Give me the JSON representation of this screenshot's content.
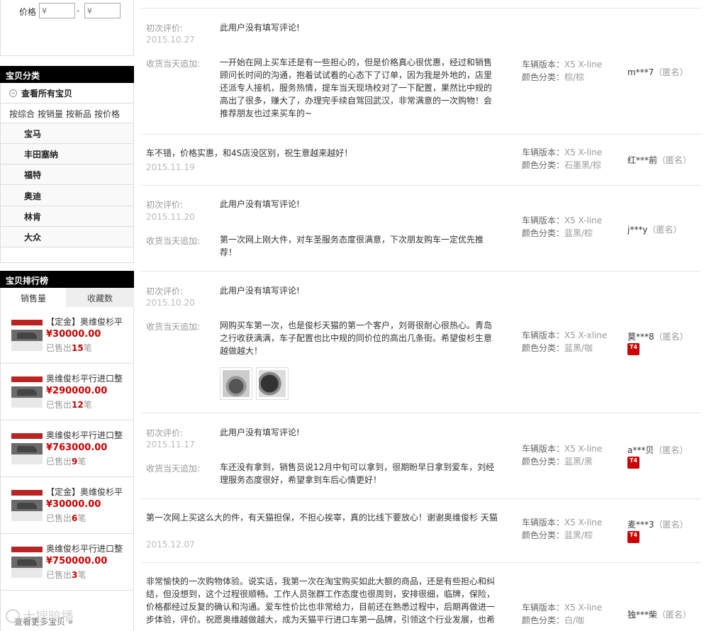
{
  "filter": {
    "price_label": "价格",
    "min_placeholder": "¥",
    "max_placeholder": "¥",
    "separator": "-"
  },
  "categories": {
    "title": "宝贝分类",
    "all_label": "查看所有宝贝",
    "sort_options": [
      "按综合",
      "按销量",
      "按新品",
      "按价格"
    ],
    "items": [
      "宝马",
      "丰田塞纳",
      "福特",
      "奥迪",
      "林肯",
      "大众"
    ]
  },
  "ranking": {
    "title": "宝贝排行榜",
    "tabs": [
      "销售量",
      "收藏数"
    ],
    "sold_prefix": "已售出",
    "sold_suffix": "笔",
    "items": [
      {
        "title": "【定金】奥维俊杉平",
        "price": "¥30000.00",
        "sold": "15"
      },
      {
        "title": "奥维俊杉平行进口整",
        "price": "¥290000.00",
        "sold": "12"
      },
      {
        "title": "奥维俊杉平行进口整",
        "price": "¥763000.00",
        "sold": "9"
      },
      {
        "title": "【定金】奥维俊杉平",
        "price": "¥30000.00",
        "sold": "6"
      },
      {
        "title": "奥维俊杉平行进口整",
        "price": "¥750000.00",
        "sold": "3"
      }
    ],
    "more_label": "查看更多宝贝 »"
  },
  "watermark": "大搜暗播",
  "labels": {
    "initial": "初次评价:",
    "append": "收货当天追加:",
    "version": "车辆版本：",
    "color": "颜色分类：",
    "anon": "（匿名）"
  },
  "reviews": [
    {
      "initial": "此用户没有填写评论!",
      "date": "2015.10.27",
      "append": "一开始在网上买车还是有一些担心的，但是价格真心很优惠，经过和销售顾问长时间的沟通，抱着试试看的心态下了订单，因为我是外地的，店里还派专人接机，服务热情，提车当天现场校对了一下配置，果然比中规的高出了很多，赚大了，办理完手续自驾回武汉，非常满意的一次购物！会推荐朋友也过来买车的~",
      "version": "X5 X-line",
      "color": "棕/棕",
      "user": "m***7"
    },
    {
      "text": "车不错，价格实惠，和4S店没区别，祝生意越来越好！",
      "date": "2015.11.19",
      "version": "X5 X-line",
      "color": "石墨黑/棕",
      "user": "红***前"
    },
    {
      "initial": "此用户没有填写评论!",
      "date": "2015.11.20",
      "append": "第一次网上刚大件，对车圣服务态度很满意，下次朋友购车一定优先推荐！",
      "version": "X5 X-line",
      "color": "蓝黑/棕",
      "user": "j***y"
    },
    {
      "initial": "此用户没有填写评论!",
      "date": "2015.10.20",
      "append": "网购买车第一次，也是俊杉天猫的第一个客户，刘哥很耐心很热心。青岛之行收获满满，车子配置也比中规的同价位的高出几条街。希望俊杉生意越做越大！",
      "version": "X5 X-xline",
      "color": "蓝黑/咖",
      "user": "莫***8",
      "badge": "T4"
    },
    {
      "initial": "此用户没有填写评论!",
      "date": "2015.11.17",
      "append": "车还没有拿到，销售员说12月中旬可以拿到，很期盼早日拿到爱车，刘经理服务态度很好，希望拿到车后心情更好！",
      "version": "X5 X-line",
      "color": "蓝黑/黑",
      "user": "a***贝",
      "badge": "T4"
    },
    {
      "text": "第一次网上买这么大的件，有天猫担保，不担心挨宰，真的比线下要放心！谢谢奥维俊杉 天猫",
      "date": "2015.12.07",
      "version": "X5 X-line",
      "color": "蓝黑/棕",
      "user": "麦***3",
      "badge": "T4"
    },
    {
      "text": "非常愉快的一次购物体验。说实话，我第一次在淘宝购买如此大额的商品，还是有些担心和纠结，但没想到，这个过程很顺畅。工作人员张群工作态度也很周到，安排很细，临牌，保险，价格都经过反复的确认和沟通。爱车性价比也非常给力，目前还在熟悉过程中，后期再做进一步体验，评价。祝愿奥维越做越大，成为天猫平行进口车第一品牌，引领这个行业发展，也希",
      "version": "X5 X-line",
      "color": "白/咖",
      "user": "独***柴"
    }
  ]
}
